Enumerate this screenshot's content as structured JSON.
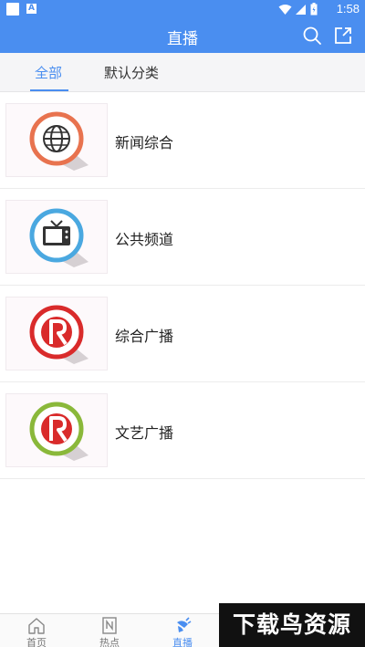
{
  "status_bar": {
    "time": "1:58",
    "icons": [
      "app-square-icon",
      "a-notification-icon",
      "wifi-icon",
      "signal-icon",
      "battery-icon"
    ],
    "a_glyph": "A"
  },
  "header": {
    "title": "直播",
    "background": "#4a8ef0",
    "icons": [
      "search-icon",
      "share-icon"
    ]
  },
  "tabs": [
    {
      "label": "全部",
      "active": true
    },
    {
      "label": "默认分类",
      "active": false
    }
  ],
  "channels": [
    {
      "label": "新闻综合",
      "icon": "globe-icon",
      "ring_color": "#e8734f"
    },
    {
      "label": "公共频道",
      "icon": "tv-icon",
      "ring_color": "#4aa8e0"
    },
    {
      "label": "综合广播",
      "icon": "radio-r-icon",
      "ring_color": "#d92b2b"
    },
    {
      "label": "文艺广播",
      "icon": "radio-r-icon",
      "ring_color": "#8ab83a"
    }
  ],
  "bottom_nav": [
    {
      "label": "首页",
      "icon": "home-icon",
      "active": false
    },
    {
      "label": "热点",
      "icon": "news-icon",
      "active": false
    },
    {
      "label": "直播",
      "icon": "live-icon",
      "active": true
    }
  ],
  "watermark": {
    "text": "下载鸟资源"
  },
  "colors": {
    "accent": "#4a8ef0"
  }
}
